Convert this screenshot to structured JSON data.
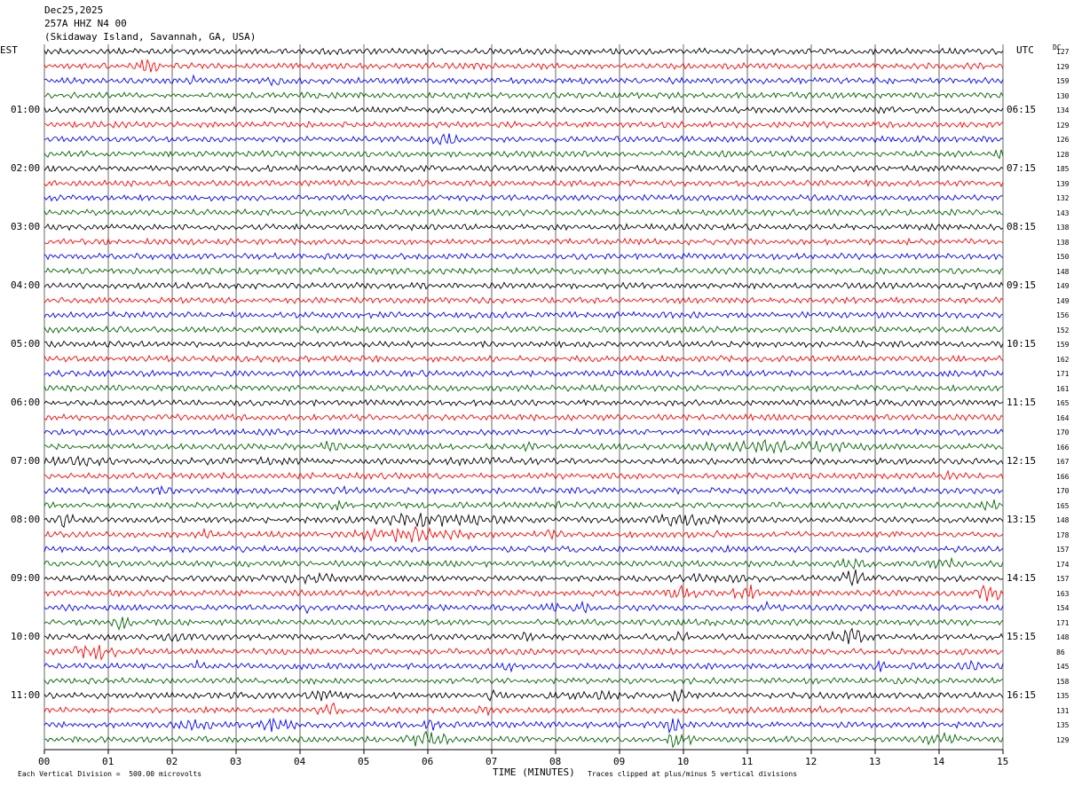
{
  "header": {
    "date": "Dec25,2025",
    "station": "257A HHZ N4 00",
    "location": "(Skidaway Island, Savannah, GA, USA)"
  },
  "chart_data": {
    "type": "line",
    "title": "Dec25,2025 257A HHZ N4 00 (Skidaway Island, Savannah, GA, USA)",
    "xlabel": "TIME (MINUTES)",
    "left_axis_label": "EST",
    "right_axis_label": "UTC",
    "dc_label": "DC",
    "x_ticks": [
      "00",
      "01",
      "02",
      "03",
      "04",
      "05",
      "06",
      "07",
      "08",
      "09",
      "10",
      "11",
      "12",
      "13",
      "14",
      "15"
    ],
    "xlim": [
      0,
      15
    ],
    "trace_count": 48,
    "minutes_per_trace": 15,
    "trace_colors": [
      "#000000",
      "#ff0000",
      "#0000ff",
      "#006400"
    ],
    "est_hour_labels": [
      "01:00",
      "02:00",
      "03:00",
      "04:00",
      "05:00",
      "06:00",
      "07:00",
      "08:00",
      "09:00",
      "10:00",
      "11:00"
    ],
    "utc_hour_labels": [
      "06:15",
      "07:15",
      "08:15",
      "09:15",
      "10:15",
      "11:15",
      "12:15",
      "13:15",
      "14:15",
      "15:15",
      "16:15"
    ],
    "dc_values": [
      127,
      129,
      159,
      130,
      134,
      129,
      126,
      128,
      185,
      139,
      132,
      143,
      138,
      138,
      150,
      148,
      149,
      149,
      156,
      152,
      159,
      162,
      171,
      161,
      165,
      164,
      170,
      166,
      167,
      166,
      170,
      165,
      148,
      178,
      157,
      174,
      157,
      163,
      154,
      171,
      148,
      86,
      145,
      158,
      135,
      131,
      135,
      129
    ],
    "vertical_division": "Each Vertical Division =  500.00 microvolts",
    "clip_note": "Traces clipped at plus/minus 5 vertical divisions",
    "bursts": [
      {
        "trace": 1,
        "minute": 1.65,
        "amp": 2.2,
        "width": 0.25
      },
      {
        "trace": 2,
        "minute": 2.35,
        "amp": 1.6,
        "width": 0.15
      },
      {
        "trace": 2,
        "minute": 3.55,
        "amp": 1.8,
        "width": 0.2
      },
      {
        "trace": 4,
        "minute": 0.95,
        "amp": 1.5,
        "width": 0.1
      },
      {
        "trace": 6,
        "minute": 6.25,
        "amp": 2.0,
        "width": 0.25
      },
      {
        "trace": 7,
        "minute": 14.95,
        "amp": 1.6,
        "width": 0.1
      },
      {
        "trace": 8,
        "minute": 0.2,
        "amp": 1.3,
        "width": 0.2
      },
      {
        "trace": 27,
        "minute": 4.4,
        "amp": 1.6,
        "width": 0.3
      },
      {
        "trace": 27,
        "minute": 7.6,
        "amp": 1.4,
        "width": 0.4
      },
      {
        "trace": 27,
        "minute": 11.5,
        "amp": 1.8,
        "width": 1.6
      },
      {
        "trace": 28,
        "minute": 0.5,
        "amp": 1.5,
        "width": 0.6
      },
      {
        "trace": 28,
        "minute": 3.2,
        "amp": 1.3,
        "width": 1.2
      },
      {
        "trace": 28,
        "minute": 7.0,
        "amp": 1.3,
        "width": 1.0
      },
      {
        "trace": 29,
        "minute": 14.1,
        "amp": 1.8,
        "width": 0.2
      },
      {
        "trace": 30,
        "minute": 1.5,
        "amp": 1.4,
        "width": 0.8
      },
      {
        "trace": 30,
        "minute": 4.6,
        "amp": 1.3,
        "width": 0.3
      },
      {
        "trace": 31,
        "minute": 4.5,
        "amp": 1.7,
        "width": 0.3
      },
      {
        "trace": 31,
        "minute": 8.0,
        "amp": 1.7,
        "width": 0.2
      },
      {
        "trace": 31,
        "minute": 14.8,
        "amp": 1.7,
        "width": 0.2
      },
      {
        "trace": 32,
        "minute": 0.3,
        "amp": 2.3,
        "width": 0.3
      },
      {
        "trace": 32,
        "minute": 6.2,
        "amp": 2.0,
        "width": 1.5
      },
      {
        "trace": 32,
        "minute": 10.0,
        "amp": 2.2,
        "width": 0.8
      },
      {
        "trace": 33,
        "minute": 2.55,
        "amp": 1.7,
        "width": 0.2
      },
      {
        "trace": 33,
        "minute": 5.7,
        "amp": 2.3,
        "width": 1.2
      },
      {
        "trace": 33,
        "minute": 7.9,
        "amp": 1.5,
        "width": 0.3
      },
      {
        "trace": 33,
        "minute": 10.3,
        "amp": 1.5,
        "width": 0.5
      },
      {
        "trace": 34,
        "minute": 10.6,
        "amp": 1.5,
        "width": 0.2
      },
      {
        "trace": 35,
        "minute": 12.7,
        "amp": 1.9,
        "width": 0.4
      },
      {
        "trace": 35,
        "minute": 14.1,
        "amp": 2.1,
        "width": 0.3
      },
      {
        "trace": 36,
        "minute": 4.1,
        "amp": 1.6,
        "width": 0.8
      },
      {
        "trace": 36,
        "minute": 10.5,
        "amp": 1.6,
        "width": 0.8
      },
      {
        "trace": 36,
        "minute": 12.7,
        "amp": 2.1,
        "width": 0.5
      },
      {
        "trace": 37,
        "minute": 10.0,
        "amp": 2.2,
        "width": 0.3
      },
      {
        "trace": 37,
        "minute": 11.0,
        "amp": 2.2,
        "width": 0.3
      },
      {
        "trace": 37,
        "minute": 14.8,
        "amp": 2.6,
        "width": 0.3
      },
      {
        "trace": 38,
        "minute": 4.1,
        "amp": 1.6,
        "width": 0.2
      },
      {
        "trace": 38,
        "minute": 8.0,
        "amp": 1.5,
        "width": 0.3
      },
      {
        "trace": 38,
        "minute": 8.4,
        "amp": 1.8,
        "width": 0.2
      },
      {
        "trace": 38,
        "minute": 11.3,
        "amp": 1.8,
        "width": 0.3
      },
      {
        "trace": 39,
        "minute": 1.2,
        "amp": 1.9,
        "width": 0.3
      },
      {
        "trace": 39,
        "minute": 14.3,
        "amp": 1.7,
        "width": 0.2
      },
      {
        "trace": 40,
        "minute": 2.0,
        "amp": 1.6,
        "width": 0.2
      },
      {
        "trace": 40,
        "minute": 7.5,
        "amp": 1.5,
        "width": 0.3
      },
      {
        "trace": 40,
        "minute": 9.9,
        "amp": 1.5,
        "width": 0.3
      },
      {
        "trace": 40,
        "minute": 12.6,
        "amp": 2.3,
        "width": 0.4
      },
      {
        "trace": 41,
        "minute": 0.8,
        "amp": 2.2,
        "width": 0.5
      },
      {
        "trace": 41,
        "minute": 7.8,
        "amp": 1.3,
        "width": 0.3
      },
      {
        "trace": 42,
        "minute": 2.4,
        "amp": 1.6,
        "width": 0.15
      },
      {
        "trace": 42,
        "minute": 7.3,
        "amp": 1.6,
        "width": 0.2
      },
      {
        "trace": 42,
        "minute": 13.1,
        "amp": 2.2,
        "width": 0.15
      },
      {
        "trace": 42,
        "minute": 14.5,
        "amp": 1.6,
        "width": 0.2
      },
      {
        "trace": 44,
        "minute": 4.4,
        "amp": 1.7,
        "width": 0.4
      },
      {
        "trace": 44,
        "minute": 7.0,
        "amp": 1.5,
        "width": 0.3
      },
      {
        "trace": 44,
        "minute": 8.5,
        "amp": 1.5,
        "width": 0.8
      },
      {
        "trace": 44,
        "minute": 9.9,
        "amp": 1.8,
        "width": 0.4
      },
      {
        "trace": 45,
        "minute": 4.5,
        "amp": 2.3,
        "width": 0.3
      },
      {
        "trace": 45,
        "minute": 6.9,
        "amp": 1.6,
        "width": 0.2
      },
      {
        "trace": 45,
        "minute": 12.1,
        "amp": 1.4,
        "width": 0.3
      },
      {
        "trace": 46,
        "minute": 2.4,
        "amp": 1.9,
        "width": 0.4
      },
      {
        "trace": 46,
        "minute": 3.6,
        "amp": 2.0,
        "width": 0.4
      },
      {
        "trace": 46,
        "minute": 6.1,
        "amp": 1.7,
        "width": 0.2
      },
      {
        "trace": 46,
        "minute": 9.8,
        "amp": 2.1,
        "width": 0.3
      },
      {
        "trace": 47,
        "minute": 6.0,
        "amp": 2.6,
        "width": 0.4
      },
      {
        "trace": 47,
        "minute": 9.9,
        "amp": 2.6,
        "width": 0.3
      },
      {
        "trace": 47,
        "minute": 14.0,
        "amp": 1.8,
        "width": 0.4
      }
    ]
  }
}
